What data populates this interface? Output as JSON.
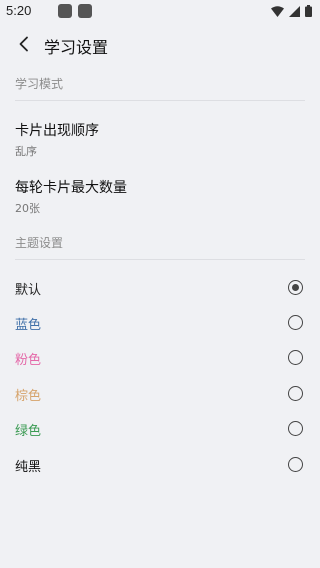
{
  "status_bar": {
    "time": "5:20",
    "icons": [
      "notification-icon",
      "notification-icon",
      "wifi-icon",
      "signal-icon",
      "battery-icon"
    ]
  },
  "header": {
    "back_icon": "chevron-left-icon",
    "title": "学习设置"
  },
  "study_mode": {
    "header": "学习模式",
    "items": [
      {
        "title": "卡片出现顺序",
        "value": "乱序"
      },
      {
        "title": "每轮卡片最大数量",
        "value": "20张"
      }
    ]
  },
  "theme": {
    "header": "主题设置",
    "options": [
      {
        "label": "默认",
        "color": "#222222",
        "selected": true
      },
      {
        "label": "蓝色",
        "color": "#3f6fa8",
        "selected": false
      },
      {
        "label": "粉色",
        "color": "#e468a8",
        "selected": false
      },
      {
        "label": "棕色",
        "color": "#d6a46c",
        "selected": false
      },
      {
        "label": "绿色",
        "color": "#3a9a52",
        "selected": false
      },
      {
        "label": "纯黑",
        "color": "#111111",
        "selected": false
      }
    ]
  }
}
